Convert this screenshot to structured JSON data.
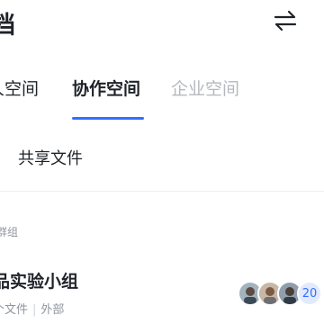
{
  "header": {
    "title": "档",
    "switch_icon": "swap-arrows-icon"
  },
  "tabs": [
    {
      "label": "人空间",
      "active": false
    },
    {
      "label": "协作空间",
      "active": true
    },
    {
      "label": "企业空间",
      "active": false
    }
  ],
  "shared": {
    "label": "共享文件"
  },
  "groups_section": {
    "label": "群组"
  },
  "group": {
    "name": "品实验小组",
    "files": "个文件",
    "scope": "外部",
    "member_count": "20"
  },
  "colors": {
    "accent": "#3370ff",
    "text_primary": "#1f2329",
    "text_secondary": "#8f959e",
    "tab_inactive": "#b4b8bf"
  }
}
